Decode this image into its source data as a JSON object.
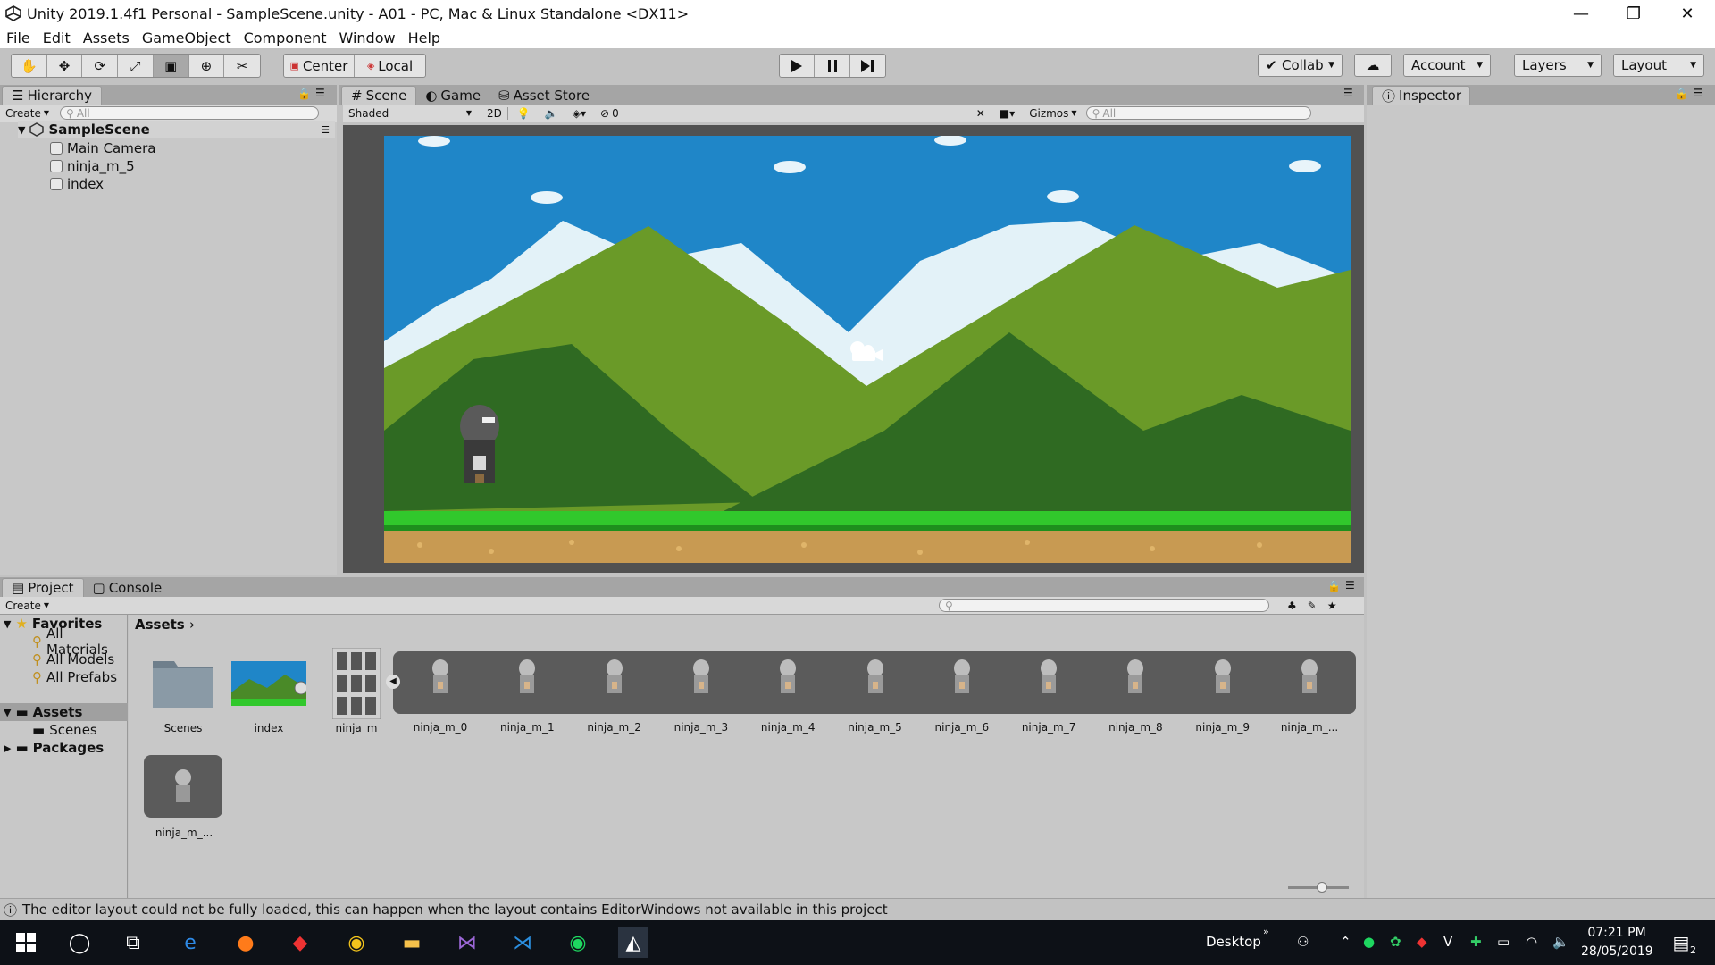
{
  "window": {
    "title": "Unity 2019.1.4f1 Personal - SampleScene.unity - A01 - PC, Mac & Linux Standalone <DX11>",
    "controls": [
      "—",
      "❐",
      "✕"
    ]
  },
  "menu": [
    "File",
    "Edit",
    "Assets",
    "GameObject",
    "Component",
    "Window",
    "Help"
  ],
  "toolbar": {
    "tools": [
      "hand-tool-icon",
      "move-tool-icon",
      "rotate-tool-icon",
      "scale-tool-icon",
      "rect-tool-icon",
      "transform-tool-icon",
      "custom-tool-icon"
    ],
    "pivot": "Center",
    "space": "Local",
    "collab": "Collab",
    "account": "Account",
    "layers": "Layers",
    "layout": "Layout"
  },
  "hierarchy": {
    "tab": "Hierarchy",
    "create": "Create",
    "search_placeholder": "All",
    "scene": "SampleScene",
    "items": [
      "Main Camera",
      "ninja_m_5",
      "index"
    ]
  },
  "scene": {
    "tabs": [
      "Scene",
      "Game",
      "Asset Store"
    ],
    "shading": "Shaded",
    "mode_2d": "2D",
    "hidden_count": "0",
    "gizmos": "Gizmos",
    "search_placeholder": "All"
  },
  "inspector": {
    "tab": "Inspector"
  },
  "project": {
    "tabs": [
      "Project",
      "Console"
    ],
    "create": "Create",
    "favorites_label": "Favorites",
    "favorites": [
      "All Materials",
      "All Models",
      "All Prefabs"
    ],
    "assets_label": "Assets",
    "assets_children": [
      "Scenes"
    ],
    "packages_label": "Packages",
    "breadcrumb": "Assets",
    "items": [
      "Scenes",
      "index",
      "ninja_m"
    ],
    "sprites": [
      "ninja_m_0",
      "ninja_m_1",
      "ninja_m_2",
      "ninja_m_3",
      "ninja_m_4",
      "ninja_m_5",
      "ninja_m_6",
      "ninja_m_7",
      "ninja_m_8",
      "ninja_m_9",
      "ninja_m_..."
    ],
    "extra_sprite": "ninja_m_..."
  },
  "status": {
    "message": "The editor layout could not be fully loaded, this can happen when the layout contains EditorWindows not available in this project"
  },
  "taskbar": {
    "desktop_label": "Desktop",
    "time": "07:21 PM",
    "date": "28/05/2019",
    "notification_count": "2"
  },
  "colors": {
    "sky": "#1f86c8",
    "mountain_light": "#6a9a28",
    "mountain_dark": "#2f6a22",
    "grass": "#31c82c",
    "dirt": "#c89a52"
  }
}
